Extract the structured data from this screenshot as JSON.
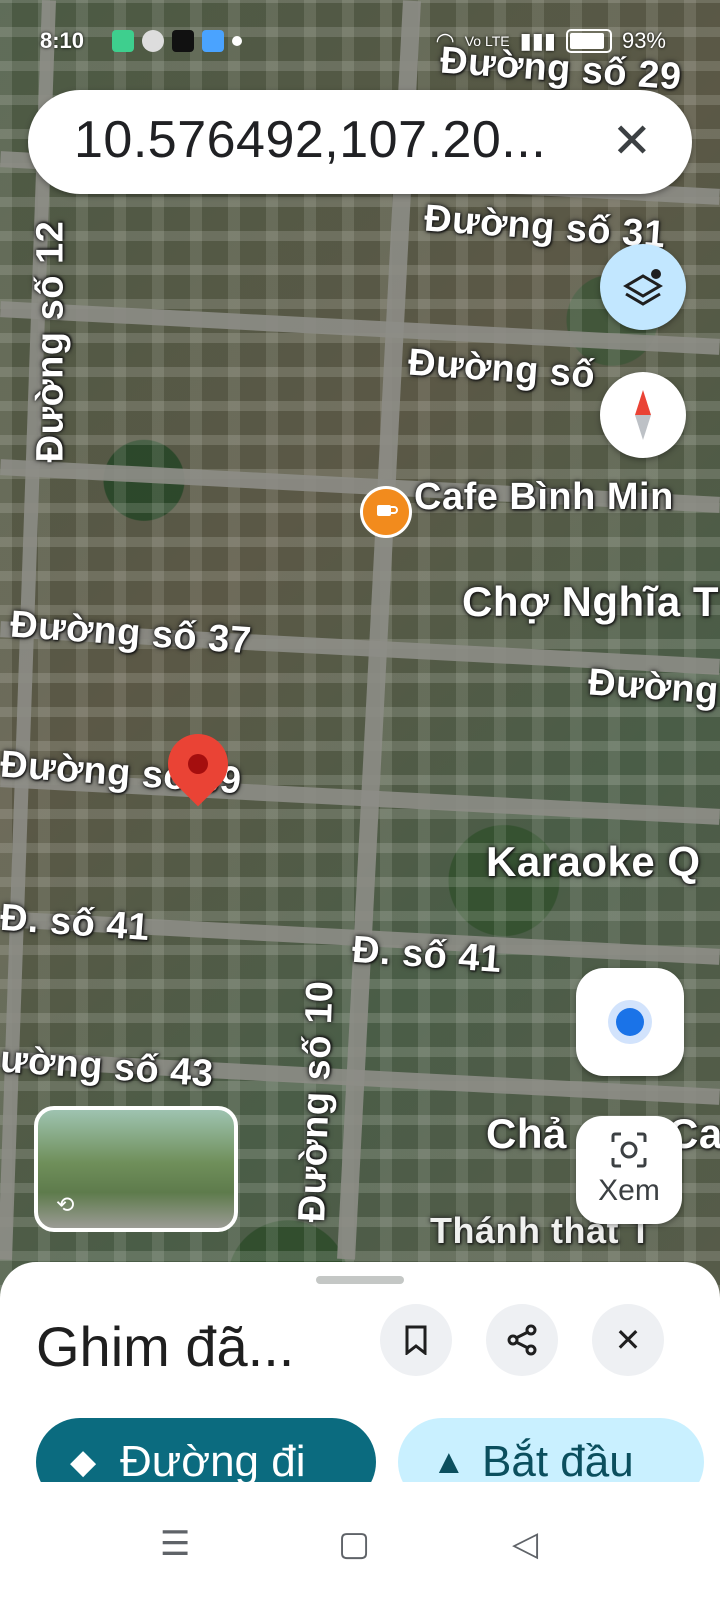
{
  "status_bar": {
    "time": "8:10",
    "network": "Vo LTE",
    "battery": "93%"
  },
  "search": {
    "query": "10.576492,107.20..."
  },
  "map": {
    "labels": [
      "Đường số 29",
      "Đường số 31",
      "Đường số 12",
      "Đường số",
      "Cafe Bình Min",
      "Chợ Nghĩa T",
      "Đường số 37",
      "Đường",
      "Đường số 39",
      "Karaoke Q",
      "Đ. số 41",
      "Đ. số 41",
      "ường số 43",
      "Đường số 10",
      "Chả",
      "Ca",
      "Thánh thất T"
    ]
  },
  "buttons": {
    "xem": "Xem"
  },
  "sheet": {
    "title": "Ghim đã...",
    "directions": "Đường đi",
    "start": "Bắt đầu"
  },
  "colors": {
    "directions_bg": "#0b6b7f",
    "start_bg": "#c9f0ff",
    "pin": "#ea4335",
    "poi": "#f28b1d"
  }
}
